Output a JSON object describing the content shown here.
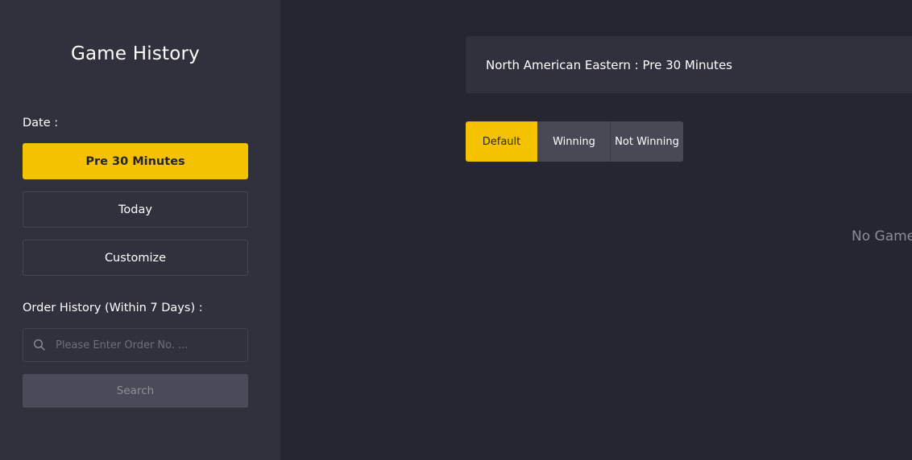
{
  "sidebar": {
    "title": "Game History",
    "date_label": "Date :",
    "date_options": [
      {
        "label": "Pre 30 Minutes",
        "active": true
      },
      {
        "label": "Today",
        "active": false
      },
      {
        "label": "Customize",
        "active": false
      }
    ],
    "order_label": "Order History (Within 7 Days) :",
    "search": {
      "placeholder": "Please Enter Order No. ...",
      "value": "",
      "icon": "search-icon",
      "button_label": "Search"
    }
  },
  "main": {
    "timezone_text": "North American Eastern : Pre 30 Minutes",
    "filters": [
      {
        "label": "Default",
        "active": true
      },
      {
        "label": "Winning",
        "active": false
      },
      {
        "label": "Not Winning",
        "active": false
      }
    ],
    "empty_text": "No Game"
  },
  "colors": {
    "accent": "#f5c200",
    "sidebar_bg": "#30313d",
    "main_bg": "#252631"
  }
}
